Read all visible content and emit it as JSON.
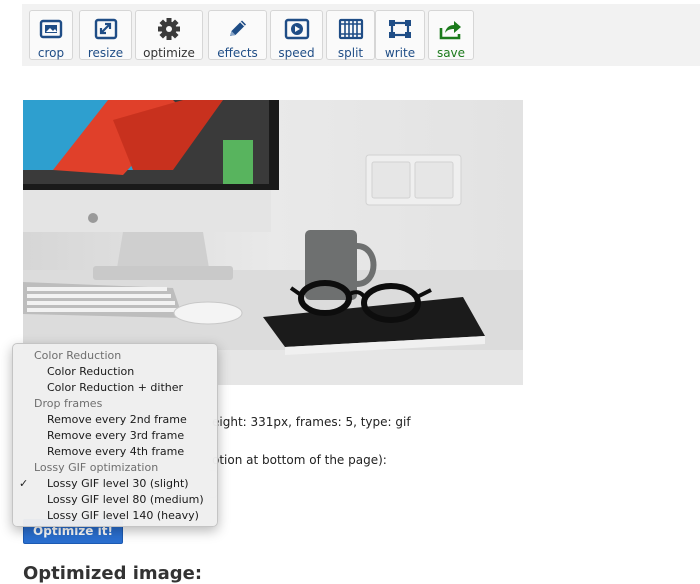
{
  "toolbar": {
    "buttons": [
      {
        "id": "crop",
        "label": "crop",
        "icon": "crop-icon"
      },
      {
        "id": "resize",
        "label": "resize",
        "icon": "resize-icon"
      },
      {
        "id": "optimize",
        "label": "optimize",
        "icon": "gear-icon"
      },
      {
        "id": "effects",
        "label": "effects",
        "icon": "pencil-icon"
      },
      {
        "id": "speed",
        "label": "speed",
        "icon": "speed-icon"
      },
      {
        "id": "split",
        "label": "split",
        "icon": "film-strip-icon"
      },
      {
        "id": "write",
        "label": "write",
        "icon": "text-frame-icon"
      },
      {
        "id": "save",
        "label": "save",
        "icon": "share-arrow-icon"
      }
    ],
    "colors": {
      "label": "#1f4d86",
      "save": "#1b7a1b",
      "icon": "#1f4d86"
    }
  },
  "image_info": {
    "text": "eight: 331px, frames: 5, type: gif"
  },
  "method": {
    "text": "otion at bottom of the page):"
  },
  "optimize_button": {
    "label": "Optimize it!",
    "color": "#2a6fd0"
  },
  "dropdown": {
    "selected": "Lossy GIF level 30 (slight)",
    "check_glyph": "✓",
    "groups": [
      {
        "label": "Color Reduction",
        "items": [
          "Color Reduction",
          "Color Reduction + dither"
        ]
      },
      {
        "label": "Drop frames",
        "items": [
          "Remove every 2nd frame",
          "Remove every 3rd frame",
          "Remove every 4th frame"
        ]
      },
      {
        "label": "Lossy GIF optimization",
        "items": [
          "Lossy GIF level 30 (slight)",
          "Lossy GIF level 80 (medium)",
          "Lossy GIF level 140 (heavy)"
        ]
      }
    ]
  },
  "result_heading": "Optimized image:"
}
